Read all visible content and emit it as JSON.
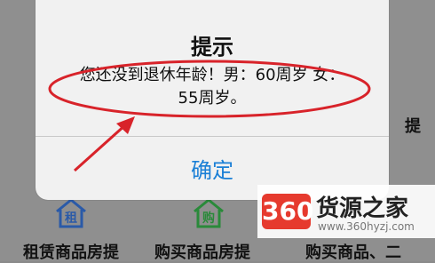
{
  "alert": {
    "title": "提示",
    "message": "您还没到退休年龄！男：60周岁 女：\n55周岁。",
    "confirm_label": "确定"
  },
  "background": {
    "side_text": "提",
    "icon_left_label": "租",
    "icon_right_label": "购",
    "bottom_left_text": "租赁商品房提",
    "bottom_mid_text": "购买商品房提",
    "bottom_right_text": "购买商品、二"
  },
  "watermark": {
    "logo_text": "360",
    "name": "货源之家",
    "url": "www.360hyzj.com"
  },
  "colors": {
    "annotation": "#d8232a",
    "link_blue": "#1a7fd6",
    "icon_blue": "#2a5aa8",
    "icon_green": "#2a8a3a"
  }
}
